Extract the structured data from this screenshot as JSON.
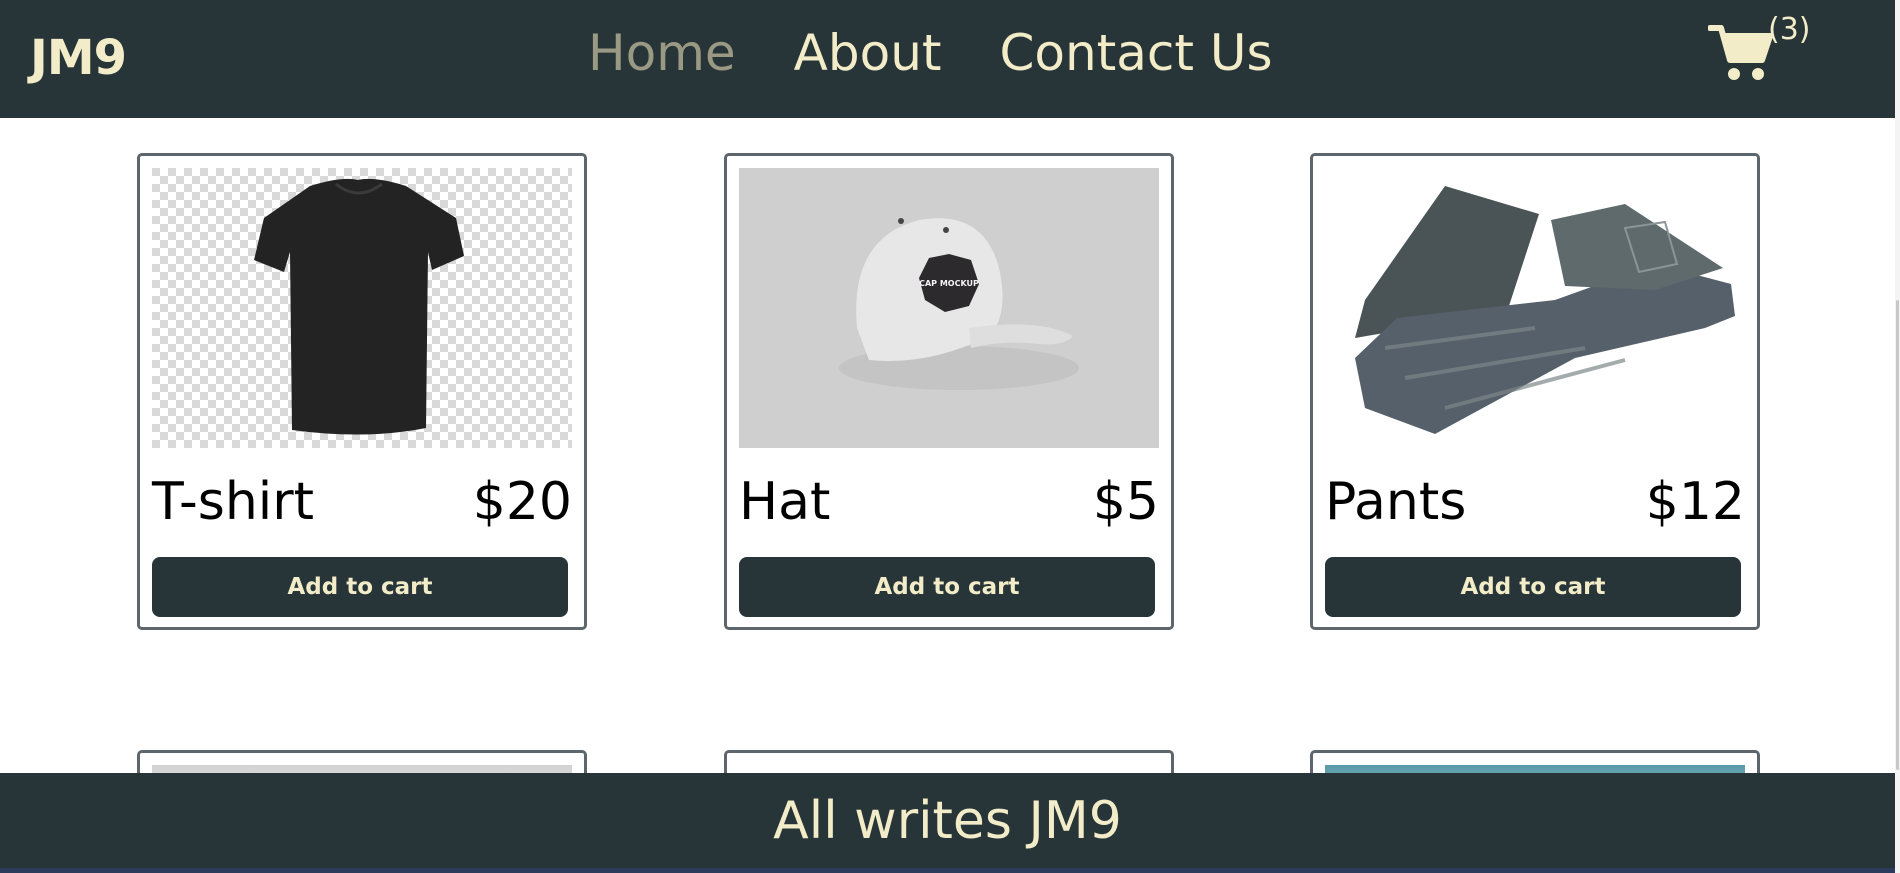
{
  "header": {
    "brand": "JM9",
    "nav": [
      "Home",
      "About",
      "Contact Us"
    ],
    "active_nav": "Home",
    "cart_icon": "shopping-cart-icon",
    "cart_count": "(3)"
  },
  "products": [
    {
      "name": "T-shirt",
      "price": "$20",
      "button": "Add to cart",
      "image": "black-tshirt-image",
      "image_text": ""
    },
    {
      "name": "Hat",
      "price": "$5",
      "button": "Add to cart",
      "image": "white-cap-image",
      "image_text": "CAP MOCKUP"
    },
    {
      "name": "Pants",
      "price": "$12",
      "button": "Add to cart",
      "image": "denim-jeans-image",
      "image_text": ""
    }
  ],
  "footer": {
    "text": "All writes JM9"
  },
  "colors": {
    "header_bg": "#283538",
    "header_text": "#f2ecc8",
    "active_nav": "#9a9a84",
    "card_border": "#5d656d"
  }
}
